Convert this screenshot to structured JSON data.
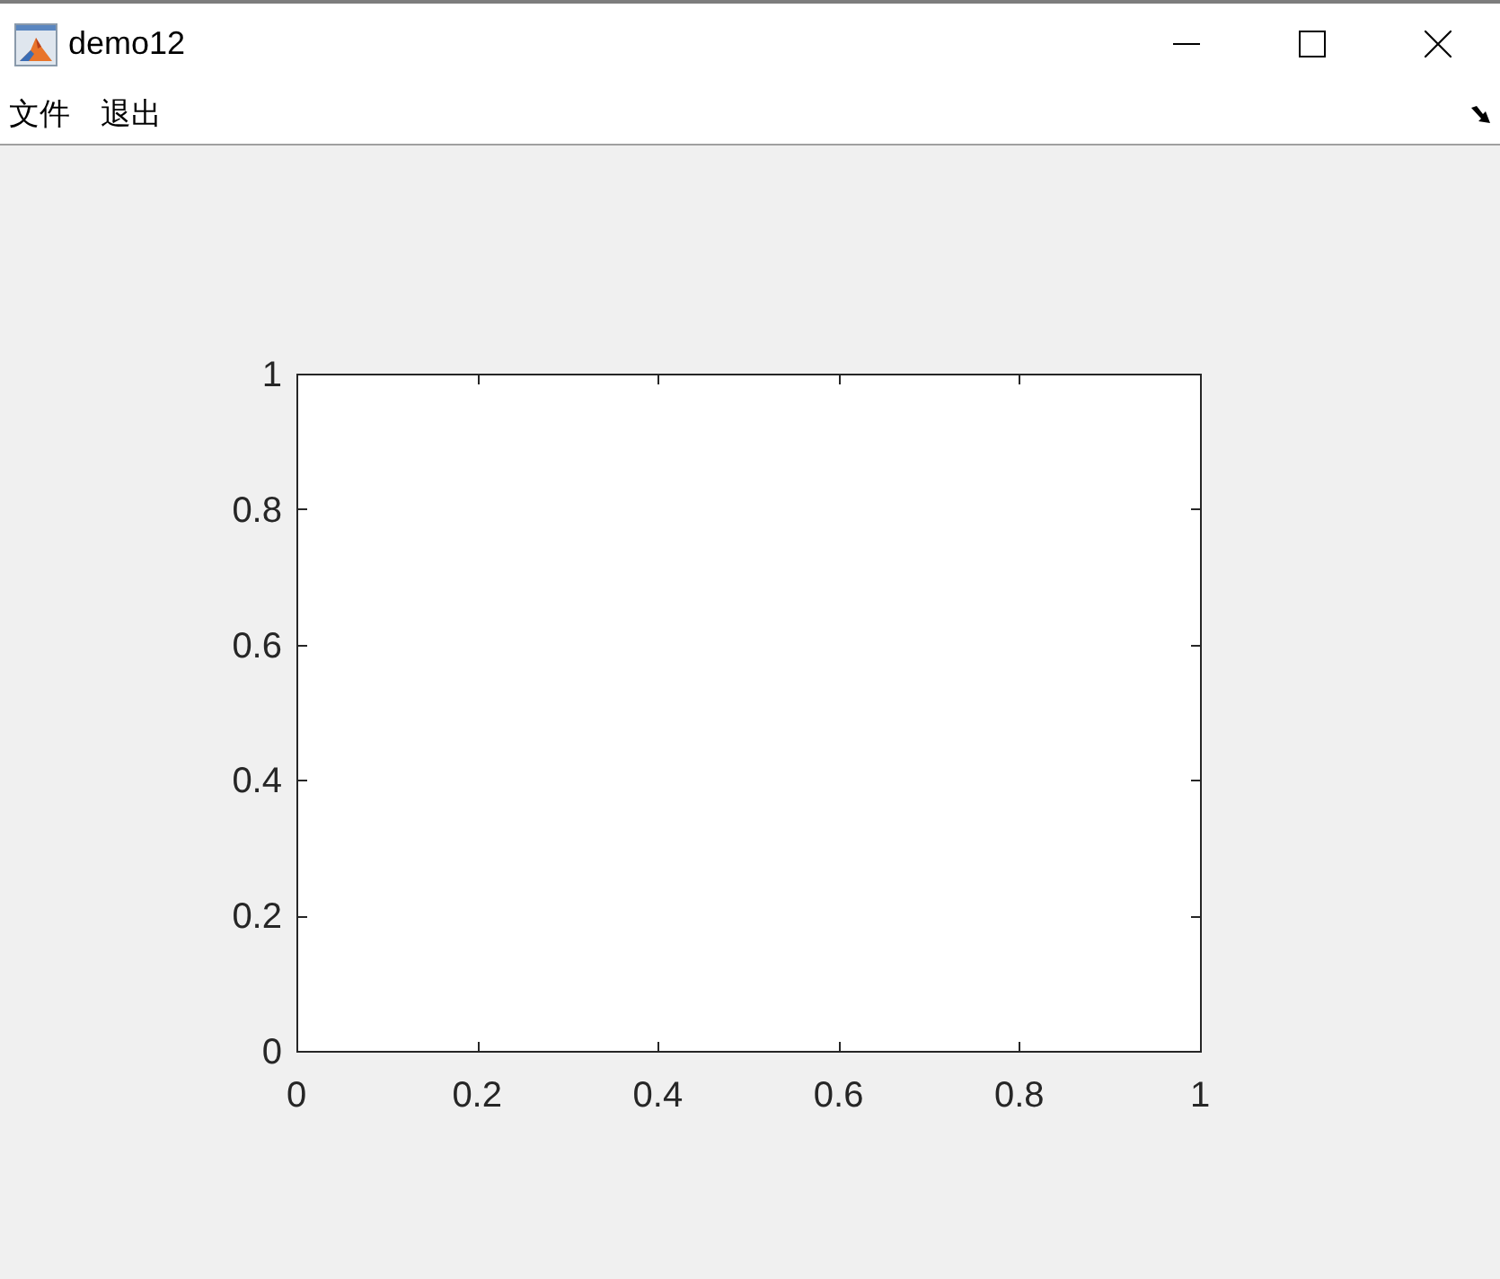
{
  "window": {
    "title": "demo12"
  },
  "menu": [
    "文件",
    "退出"
  ],
  "figure": {
    "axes": {
      "chart_data": {
        "type": "line",
        "xlim": [
          0,
          1
        ],
        "ylim": [
          0,
          1
        ],
        "xticks": [
          0,
          0.2,
          0.4,
          0.6,
          0.8,
          1
        ],
        "yticks": [
          0,
          0.2,
          0.4,
          0.6,
          0.8,
          1
        ]
      }
    }
  }
}
